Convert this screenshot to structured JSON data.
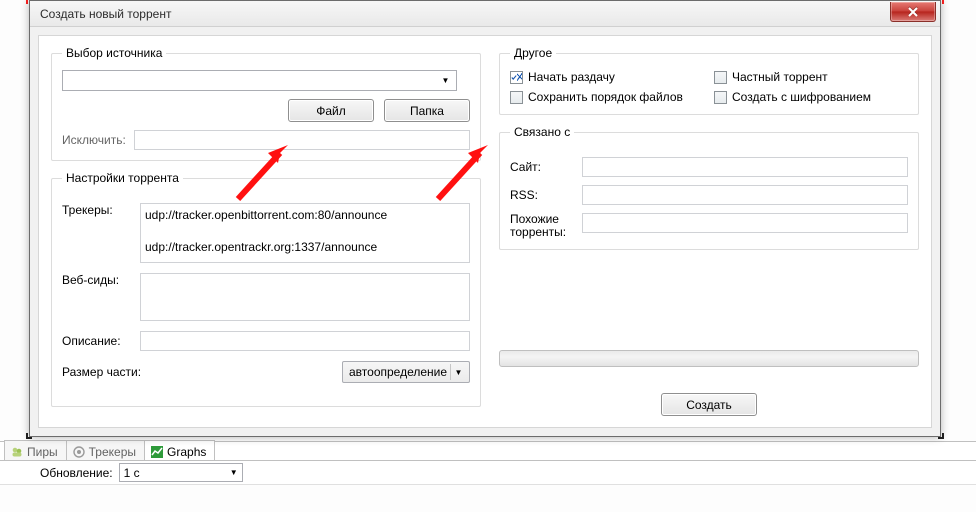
{
  "dialog": {
    "title": "Создать новый торрент"
  },
  "source": {
    "legend": "Выбор источника",
    "combo_value": "",
    "file_btn": "Файл",
    "folder_btn": "Папка",
    "exclude_label": "Исключить:",
    "exclude_value": ""
  },
  "settings": {
    "legend": "Настройки торрента",
    "trackers_label": "Трекеры:",
    "trackers_value": "udp://tracker.openbittorrent.com:80/announce\n\nudp://tracker.opentrackr.org:1337/announce",
    "webseeds_label": "Веб-сиды:",
    "webseeds_value": "",
    "description_label": "Описание:",
    "description_value": "",
    "piece_label": "Размер части:",
    "piece_value": "автоопределение"
  },
  "other": {
    "legend": "Другое",
    "start_seeding": {
      "label": "Начать раздачу",
      "checked": true
    },
    "private": {
      "label": "Частный торрент",
      "checked": false
    },
    "preserve_order": {
      "label": "Сохранить порядок файлов",
      "checked": false
    },
    "encrypt": {
      "label": "Создать с шифрованием",
      "checked": false
    }
  },
  "related": {
    "legend": "Связано с",
    "site_label": "Сайт:",
    "site_value": "",
    "rss_label": "RSS:",
    "rss_value": "",
    "similar_label": "Похожие\nторренты:",
    "similar_value": ""
  },
  "create_btn": "Создать",
  "bg": {
    "tab_peers": "Пиры",
    "tab_trackers": "Трекеры",
    "tab_graphs": "Graphs",
    "update_label": "Обновление:",
    "update_value": "1 с"
  }
}
